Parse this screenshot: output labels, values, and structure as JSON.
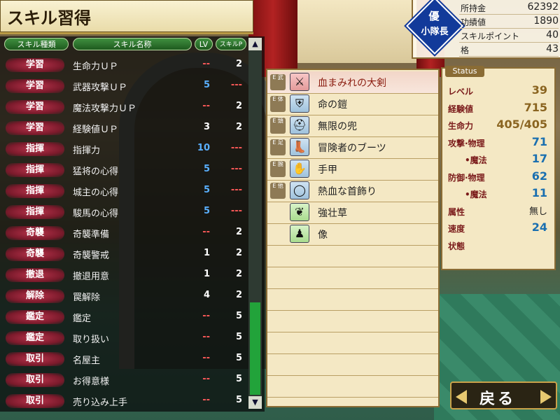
{
  "title": "スキル習得",
  "headers": {
    "type": "スキル種類",
    "name": "スキル名称",
    "lv": "LV",
    "sp": "スキルP"
  },
  "scroll": {
    "up": "▲",
    "down": "▼"
  },
  "skills": [
    {
      "cat": "学習",
      "name": "生命力ＵＰ",
      "lv": "--",
      "lv_color": "red",
      "sp": "2",
      "sp_color": "white"
    },
    {
      "cat": "学習",
      "name": "武器攻撃ＵＰ",
      "lv": "5",
      "lv_color": "blue",
      "sp": "---",
      "sp_color": "red"
    },
    {
      "cat": "学習",
      "name": "魔法攻撃力ＵＰ",
      "lv": "--",
      "lv_color": "red",
      "sp": "2",
      "sp_color": "white"
    },
    {
      "cat": "学習",
      "name": "経験値ＵＰ",
      "lv": "3",
      "lv_color": "white",
      "sp": "2",
      "sp_color": "white"
    },
    {
      "cat": "指揮",
      "name": "指揮力",
      "lv": "10",
      "lv_color": "blue",
      "sp": "---",
      "sp_color": "red"
    },
    {
      "cat": "指揮",
      "name": "猛将の心得",
      "lv": "5",
      "lv_color": "blue",
      "sp": "---",
      "sp_color": "red"
    },
    {
      "cat": "指揮",
      "name": "城主の心得",
      "lv": "5",
      "lv_color": "blue",
      "sp": "---",
      "sp_color": "red"
    },
    {
      "cat": "指揮",
      "name": "駿馬の心得",
      "lv": "5",
      "lv_color": "blue",
      "sp": "---",
      "sp_color": "red"
    },
    {
      "cat": "奇襲",
      "name": "奇襲準備",
      "lv": "--",
      "lv_color": "red",
      "sp": "2",
      "sp_color": "white"
    },
    {
      "cat": "奇襲",
      "name": "奇襲警戒",
      "lv": "1",
      "lv_color": "white",
      "sp": "2",
      "sp_color": "white"
    },
    {
      "cat": "撤退",
      "name": "撤退用意",
      "lv": "1",
      "lv_color": "white",
      "sp": "2",
      "sp_color": "white"
    },
    {
      "cat": "解除",
      "name": "罠解除",
      "lv": "4",
      "lv_color": "white",
      "sp": "2",
      "sp_color": "white"
    },
    {
      "cat": "鑑定",
      "name": "鑑定",
      "lv": "--",
      "lv_color": "red",
      "sp": "5",
      "sp_color": "white"
    },
    {
      "cat": "鑑定",
      "name": "取り扱い",
      "lv": "--",
      "lv_color": "red",
      "sp": "5",
      "sp_color": "white"
    },
    {
      "cat": "取引",
      "name": "名屋主",
      "lv": "--",
      "lv_color": "red",
      "sp": "5",
      "sp_color": "white"
    },
    {
      "cat": "取引",
      "name": "お得意様",
      "lv": "--",
      "lv_color": "red",
      "sp": "5",
      "sp_color": "white"
    },
    {
      "cat": "取引",
      "name": "売り込み上手",
      "lv": "--",
      "lv_color": "red",
      "sp": "5",
      "sp_color": "white"
    }
  ],
  "inventory": [
    {
      "slot": "E 武",
      "icon": "sword-icon",
      "glyph": "⚔",
      "name": "血まみれの大剣",
      "style": "weapon",
      "highlight": true
    },
    {
      "slot": "E 体",
      "icon": "armor-icon",
      "glyph": "⛨",
      "name": "命の鎧",
      "style": "armor",
      "highlight": false
    },
    {
      "slot": "E 頭",
      "icon": "helmet-icon",
      "glyph": "⛑",
      "name": "無限の兜",
      "style": "armor",
      "highlight": false
    },
    {
      "slot": "E 足",
      "icon": "boots-icon",
      "glyph": "👢",
      "name": "冒険者のブーツ",
      "style": "armor",
      "highlight": false
    },
    {
      "slot": "E 腕",
      "icon": "gauntlet-icon",
      "glyph": "✋",
      "name": "手甲",
      "style": "armor",
      "highlight": false
    },
    {
      "slot": "E 他",
      "icon": "necklace-icon",
      "glyph": "◯",
      "name": "熱血な首飾り",
      "style": "armor",
      "highlight": false
    },
    {
      "slot": "",
      "icon": "herb-icon",
      "glyph": "❦",
      "name": "強壮草",
      "style": "herb",
      "highlight": false
    },
    {
      "slot": "",
      "icon": "statue-icon",
      "glyph": "♟",
      "name": "像",
      "style": "herb",
      "highlight": false
    }
  ],
  "status": {
    "tab": "Status",
    "items": [
      {
        "label": "レベル",
        "value": "39",
        "style": "gold"
      },
      {
        "label": "経験値",
        "value": "715",
        "style": "gold"
      },
      {
        "label": "生命力",
        "value": "405/405",
        "style": "gold"
      },
      {
        "label": "攻撃·物理",
        "value": "71",
        "style": "blue"
      },
      {
        "label": "　　•魔法",
        "value": "17",
        "style": "blue"
      },
      {
        "label": "防御·物理",
        "value": "62",
        "style": "blue"
      },
      {
        "label": "　　•魔法",
        "value": "11",
        "style": "blue"
      },
      {
        "label": "属性",
        "value": "無し",
        "style": "plain"
      },
      {
        "label": "速度",
        "value": "24",
        "style": "blue"
      },
      {
        "label": "状態",
        "value": "",
        "style": "plain"
      }
    ]
  },
  "info": {
    "rank_top": "優",
    "rank_bottom": "小隊長",
    "rows": [
      {
        "key": "所持金",
        "value": "62392"
      },
      {
        "key": "功績値",
        "value": "1890"
      },
      {
        "key": "スキルポイント",
        "value": "40"
      },
      {
        "key": "格",
        "value": "43"
      }
    ]
  },
  "back_label": "戻る"
}
